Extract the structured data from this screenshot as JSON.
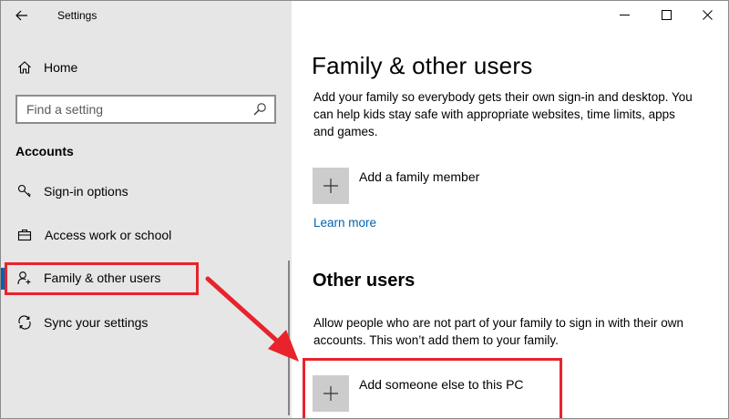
{
  "window": {
    "title": "Settings",
    "controls": {
      "minimize": "—",
      "maximize": "☐",
      "close": "✕"
    }
  },
  "sidebar": {
    "home_label": "Home",
    "search_placeholder": "Find a setting",
    "section_heading": "Accounts",
    "items": [
      {
        "label": "Sign-in options",
        "icon": "key-icon"
      },
      {
        "label": "Access work or school",
        "icon": "briefcase-icon"
      },
      {
        "label": "Family & other users",
        "icon": "add-user-icon",
        "selected": true
      },
      {
        "label": "Sync your settings",
        "icon": "sync-icon"
      }
    ]
  },
  "main": {
    "title": "Family & other users",
    "family_description": "Add your family so everybody gets their own sign-in and desktop. You can help kids stay safe with appropriate websites, time limits, apps and games.",
    "add_family_label": "Add a family member",
    "learn_more": "Learn more",
    "other_users_heading": "Other users",
    "other_users_description": "Allow people who are not part of your family to sign in with their own accounts. This won’t add them to your family.",
    "add_other_label": "Add someone else to this PC"
  },
  "colors": {
    "accent": "#0063b1",
    "annotation": "#e8232c",
    "sidebar_bg": "#e6e6e6",
    "tile_bg": "#cccccc"
  }
}
